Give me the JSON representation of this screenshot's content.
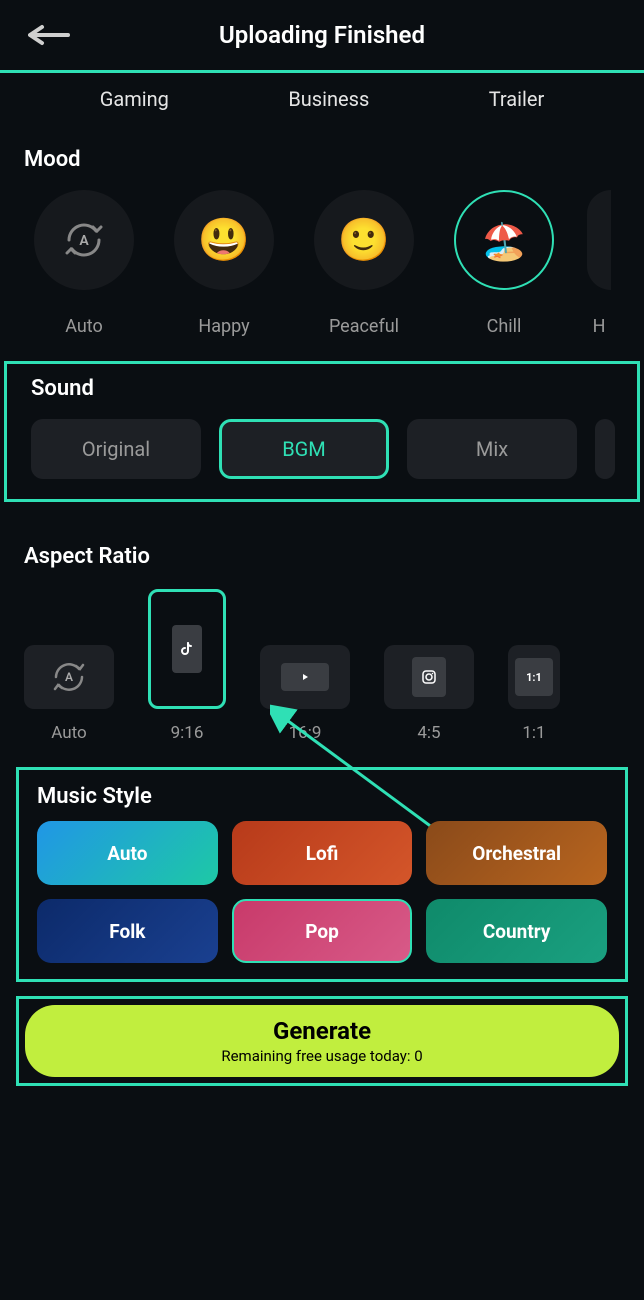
{
  "header": {
    "title": "Uploading Finished"
  },
  "categories": [
    "Gaming",
    "Business",
    "Trailer"
  ],
  "mood": {
    "title": "Mood",
    "items": [
      {
        "label": "Auto",
        "selected": false
      },
      {
        "label": "Happy",
        "selected": false
      },
      {
        "label": "Peaceful",
        "selected": false
      },
      {
        "label": "Chill",
        "selected": true
      },
      {
        "label": "H",
        "selected": false
      }
    ]
  },
  "sound": {
    "title": "Sound",
    "items": [
      {
        "label": "Original",
        "selected": false
      },
      {
        "label": "BGM",
        "selected": true
      },
      {
        "label": "Mix",
        "selected": false
      }
    ]
  },
  "aspect": {
    "title": "Aspect Ratio",
    "items": [
      {
        "label": "Auto",
        "selected": false
      },
      {
        "label": "9:16",
        "selected": true
      },
      {
        "label": "16:9",
        "selected": false
      },
      {
        "label": "4:5",
        "selected": false
      },
      {
        "label": "1:1",
        "selected": false
      }
    ]
  },
  "music": {
    "title": "Music Style",
    "items": [
      {
        "label": "Auto",
        "selected": false
      },
      {
        "label": "Lofi",
        "selected": false
      },
      {
        "label": "Orchestral",
        "selected": false
      },
      {
        "label": "Folk",
        "selected": false
      },
      {
        "label": "Pop",
        "selected": true
      },
      {
        "label": "Country",
        "selected": false
      }
    ]
  },
  "generate": {
    "label": "Generate",
    "sub": "Remaining free usage today: 0"
  }
}
